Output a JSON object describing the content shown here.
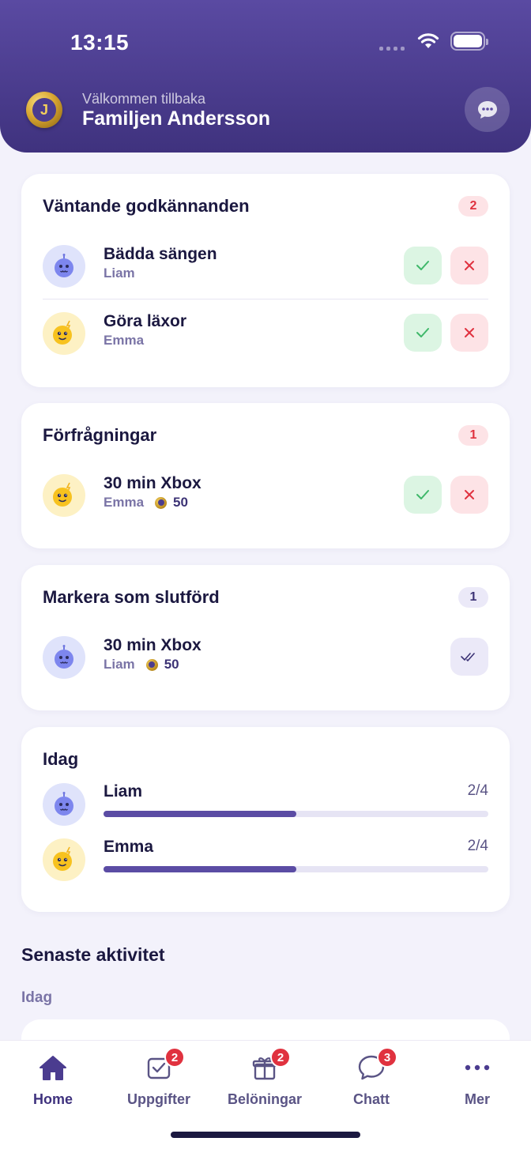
{
  "status_bar": {
    "time": "13:15"
  },
  "header": {
    "logo_letter": "J",
    "welcome": "Välkommen tillbaka",
    "family_name": "Familjen Andersson"
  },
  "pending_approvals": {
    "title": "Väntande godkännanden",
    "count": "2",
    "items": [
      {
        "task": "Bädda sängen",
        "child": "Liam"
      },
      {
        "task": "Göra läxor",
        "child": "Emma"
      }
    ]
  },
  "requests": {
    "title": "Förfrågningar",
    "count": "1",
    "items": [
      {
        "reward": "30 min Xbox",
        "child": "Emma",
        "cost": "50"
      }
    ]
  },
  "mark_done": {
    "title": "Markera som slutförd",
    "count": "1",
    "items": [
      {
        "reward": "30 min Xbox",
        "child": "Liam",
        "cost": "50"
      }
    ]
  },
  "today": {
    "title": "Idag",
    "children": [
      {
        "name": "Liam",
        "progress_text": "2/4",
        "progress": 0.5
      },
      {
        "name": "Emma",
        "progress_text": "2/4",
        "progress": 0.5
      }
    ]
  },
  "recent_activity": {
    "title": "Senaste aktivitet",
    "group_label": "Idag"
  },
  "tabbar": {
    "tabs": [
      {
        "label": "Home",
        "icon": "home-icon",
        "badge": ""
      },
      {
        "label": "Uppgifter",
        "icon": "task-check-icon",
        "badge": "2"
      },
      {
        "label": "Belöningar",
        "icon": "gift-icon",
        "badge": "2"
      },
      {
        "label": "Chatt",
        "icon": "chat-bubble-icon",
        "badge": "3"
      },
      {
        "label": "Mer",
        "icon": "more-dots-icon",
        "badge": ""
      }
    ]
  },
  "colors": {
    "header_gradient_top": "#5a4aa2",
    "header_gradient_bottom": "#3f327e",
    "approve": "#3fb86a",
    "reject": "#e0323f",
    "progress": "#5b4ca4",
    "liam_avatar": "#dfe3fb",
    "emma_avatar": "#fdf1c4"
  }
}
